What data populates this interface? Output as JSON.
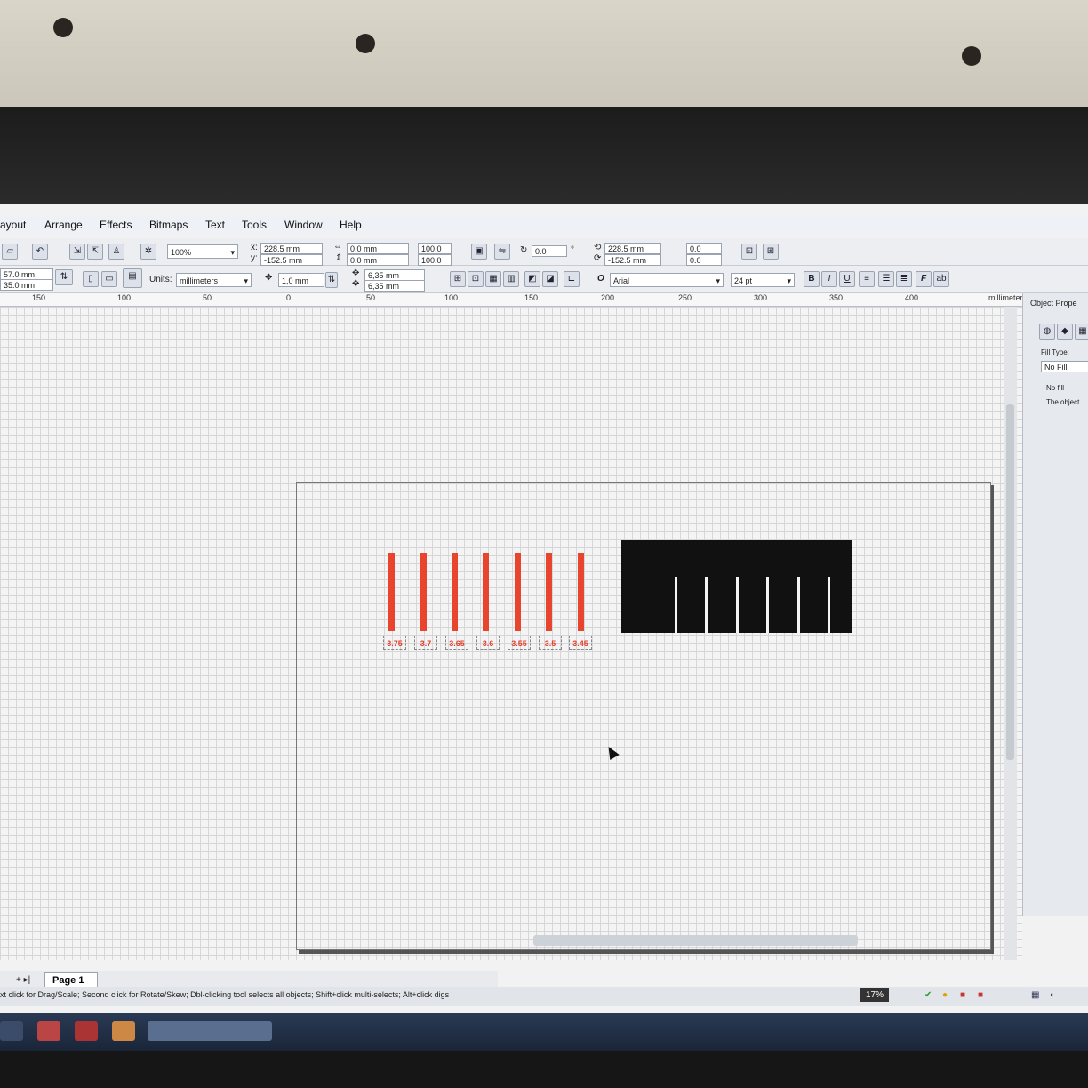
{
  "menu": [
    "ayout",
    "Arrange",
    "Effects",
    "Bitmaps",
    "Text",
    "Tools",
    "Window",
    "Help"
  ],
  "toolbar": {
    "zoom": "100%",
    "x": "228.5 mm",
    "y": "-152.5 mm",
    "w": "0.0 mm",
    "h": "0.0 mm",
    "scale_w": "100.0",
    "scale_h": "100.0",
    "rotate": "0.0",
    "x2": "228.5 mm",
    "y2": "-152.5 mm",
    "pos1": "0.0",
    "pos2": "0.0"
  },
  "toolbar2": {
    "page_w": "57.0 mm",
    "page_h": "35.0 mm",
    "units_label": "Units:",
    "units_value": "millimeters",
    "nudge": "1,0 mm",
    "dup_x": "6,35 mm",
    "dup_y": "6,35 mm",
    "font": "Arial",
    "font_size": "24 pt"
  },
  "ruler": {
    "ticks": [
      "150",
      "100",
      "50",
      "0",
      "50",
      "100",
      "150",
      "200",
      "250",
      "300",
      "350",
      "400"
    ],
    "unit": "millimeters"
  },
  "drawing": {
    "labels": [
      "3.75",
      "3.7",
      "3.65",
      "3.6",
      "3.55",
      "3.5",
      "3.45"
    ]
  },
  "panel": {
    "title": "Object Prope",
    "fill_type_label": "Fill Type:",
    "fill_value": "No Fill",
    "no_fill": "No fill",
    "note": "The object"
  },
  "pages": {
    "nav": "+ ▸|",
    "tab": "Page 1"
  },
  "status": {
    "text": "xt click for Drag/Scale; Second click for Rotate/Skew; Dbl-clicking tool selects all objects; Shift+click multi-selects; Alt+click digs",
    "zoom": "17%"
  }
}
